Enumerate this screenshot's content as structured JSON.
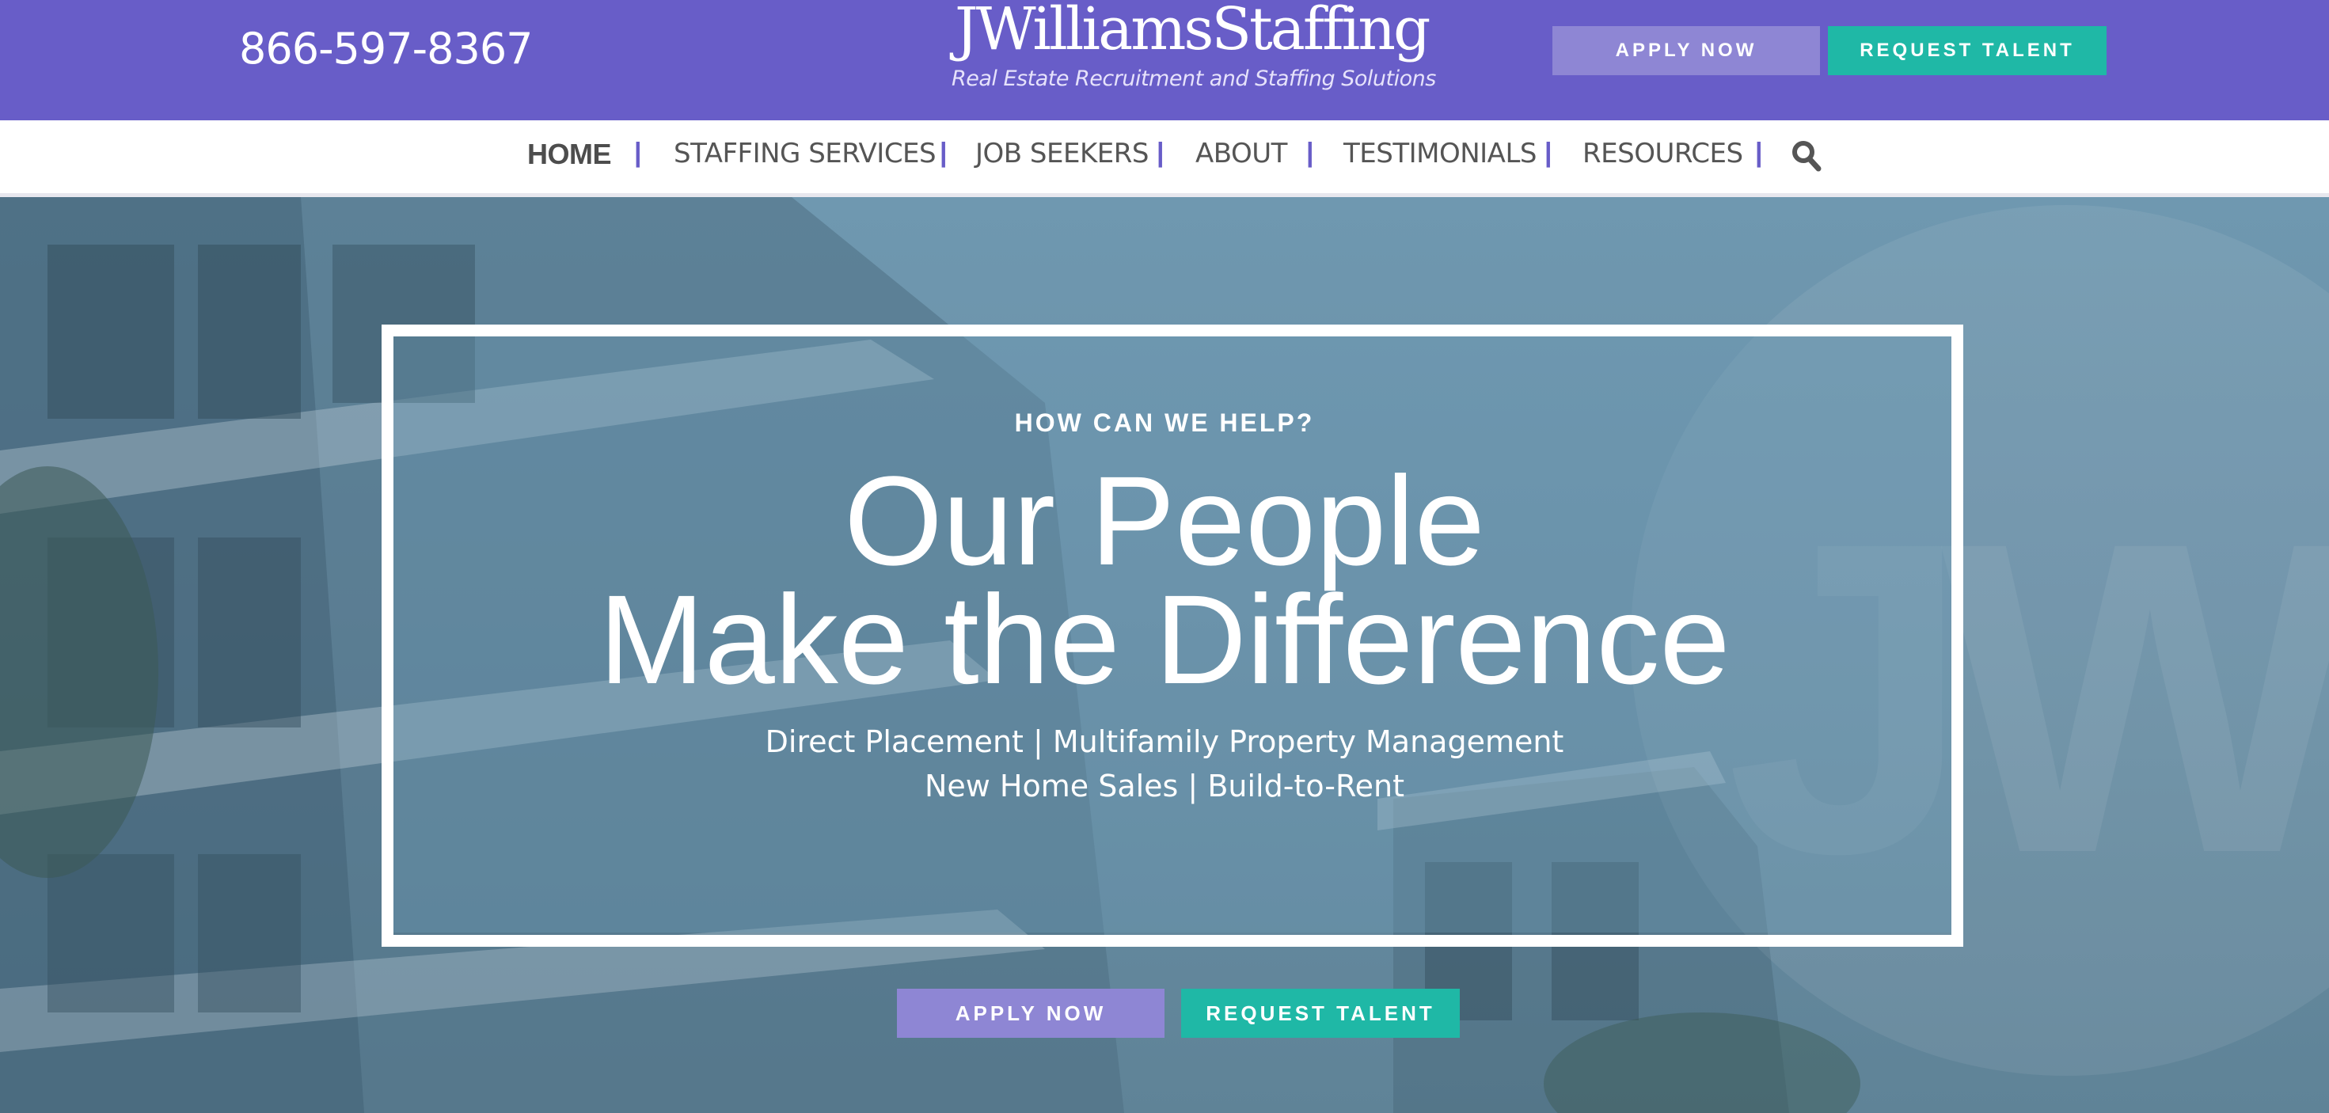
{
  "header": {
    "phone": "866-597-8367",
    "logo_name": "JWilliamsStaffing",
    "logo_tagline": "Real Estate Recruitment and Staffing Solutions",
    "apply_label": "APPLY NOW",
    "talent_label": "REQUEST TALENT"
  },
  "nav": {
    "items": [
      {
        "label": "HOME"
      },
      {
        "label": "STAFFING SERVICES"
      },
      {
        "label": "JOB SEEKERS"
      },
      {
        "label": "ABOUT"
      },
      {
        "label": "TESTIMONIALS"
      },
      {
        "label": "RESOURCES"
      }
    ],
    "separator": "|",
    "search_icon": "search-icon"
  },
  "hero": {
    "eyebrow": "HOW CAN WE HELP?",
    "headline_line1": "Our People",
    "headline_line2": "Make the Difference",
    "sub_line1": "Direct Placement | Multifamily Property Management",
    "sub_line2": "New Home Sales | Build-to-Rent",
    "apply_label": "APPLY NOW",
    "talent_label": "REQUEST TALENT"
  },
  "colors": {
    "brand_purple": "#685dc8",
    "apply_purple": "#8e86d4",
    "teal": "#1fb8a6"
  }
}
